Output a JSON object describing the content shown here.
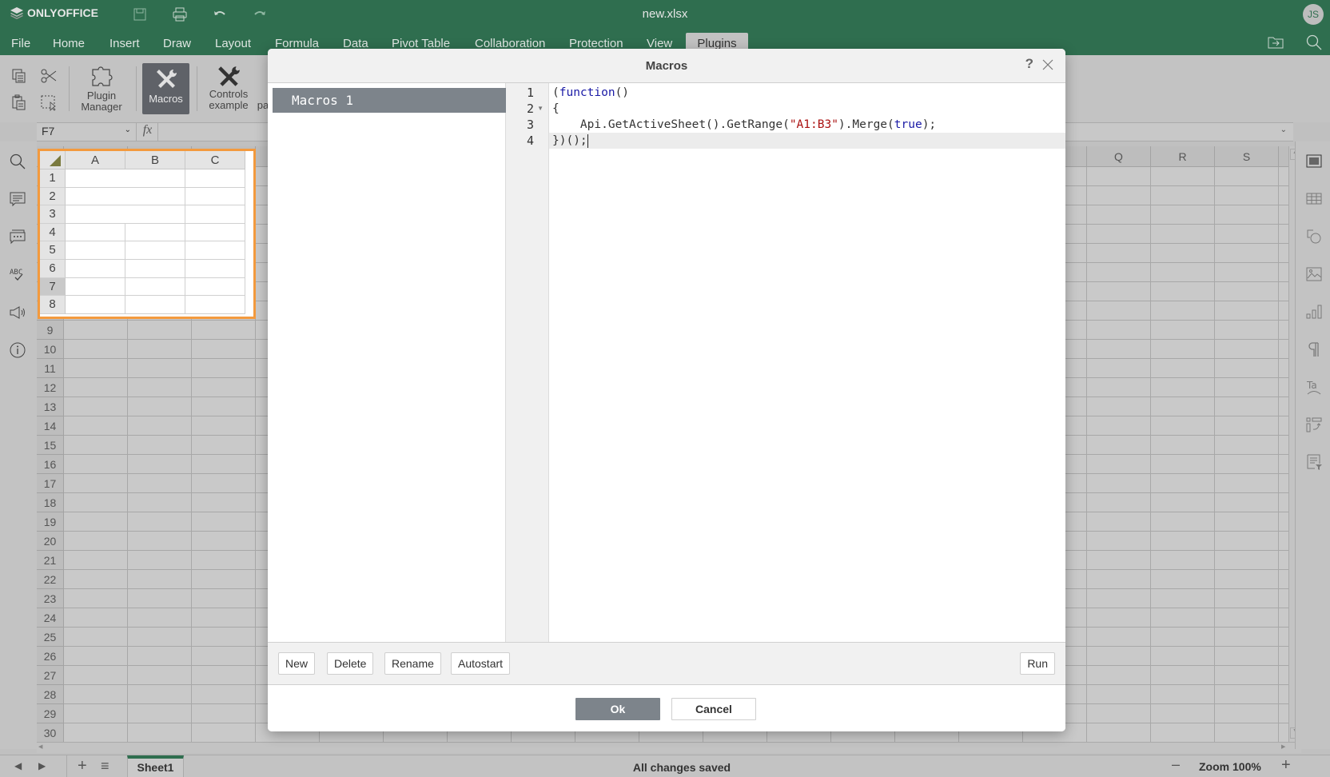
{
  "app": {
    "brand": "ONLYOFFICE",
    "document_title": "new.xlsx",
    "user_initials": "JS"
  },
  "menu": {
    "tabs": [
      {
        "label": "File"
      },
      {
        "label": "Home"
      },
      {
        "label": "Insert"
      },
      {
        "label": "Draw"
      },
      {
        "label": "Layout"
      },
      {
        "label": "Formula"
      },
      {
        "label": "Data"
      },
      {
        "label": "Pivot Table"
      },
      {
        "label": "Collaboration"
      },
      {
        "label": "Protection"
      },
      {
        "label": "View"
      },
      {
        "label": "Plugins"
      }
    ],
    "active": "Plugins"
  },
  "toolbar": {
    "plugin_manager": "Plugin\nManager",
    "plugin_manager_l1": "Plugin",
    "plugin_manager_l2": "Manager",
    "macros": "Macros",
    "controls_l1": "Controls",
    "controls_l2": "example",
    "partial_l2": "pa"
  },
  "formula_bar": {
    "cell_ref": "F7",
    "fx_label": "fx",
    "value": ""
  },
  "sheet": {
    "visible_columns_left": [
      "A",
      "B",
      "C"
    ],
    "visible_columns_right": [
      "Q",
      "R",
      "S"
    ],
    "rows": [
      "1",
      "2",
      "3",
      "4",
      "5",
      "6",
      "7",
      "8",
      "9",
      "10",
      "11",
      "12",
      "13",
      "14",
      "15",
      "16",
      "17",
      "18",
      "19",
      "20",
      "21",
      "22",
      "23",
      "24",
      "25",
      "26",
      "27",
      "28",
      "29",
      "30"
    ],
    "merged_range": "A1:B3",
    "selected_row": "7"
  },
  "dialog": {
    "title": "Macros",
    "help": "?",
    "macros": [
      {
        "name": "Macros 1",
        "selected": true
      }
    ],
    "code_lines": [
      {
        "num": "1",
        "text": "(function()"
      },
      {
        "num": "2",
        "text": "{"
      },
      {
        "num": "3",
        "text": "    Api.GetActiveSheet().GetRange(\"A1:B3\").Merge(true);"
      },
      {
        "num": "4",
        "text": "})();"
      }
    ],
    "code_tokens": {
      "l1_paren": "(",
      "l1_kw": "function",
      "l1_rest": "()",
      "l2": "{",
      "l3_pre": "    Api.GetActiveSheet().GetRange(",
      "l3_str": "\"A1:B3\"",
      "l3_mid": ").Merge(",
      "l3_kw": "true",
      "l3_end": ");",
      "l4": "})();"
    },
    "buttons": {
      "new": "New",
      "delete": "Delete",
      "rename": "Rename",
      "autostart": "Autostart",
      "run": "Run"
    },
    "ok": "Ok",
    "cancel": "Cancel"
  },
  "statusbar": {
    "sheet_tab": "Sheet1",
    "status": "All changes saved",
    "zoom": "Zoom 100%"
  }
}
